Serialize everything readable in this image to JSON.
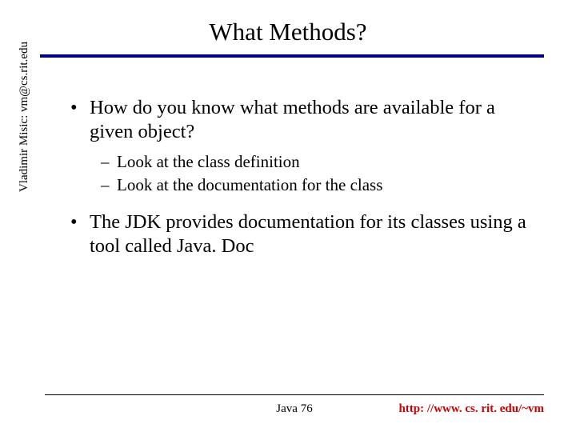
{
  "title": "What Methods?",
  "sidebar_text": "Vladimir Misic: vm@cs.rit.edu",
  "content": {
    "bullet1": "How do you know what methods are available for a given object?",
    "sub1": "Look at the class definition",
    "sub2": "Look at the documentation for the class",
    "bullet2": "The JDK provides documentation for its classes using a tool called Java. Doc"
  },
  "footer": {
    "center": "Java 76",
    "right": "http: //www. cs. rit. edu/~vm"
  }
}
